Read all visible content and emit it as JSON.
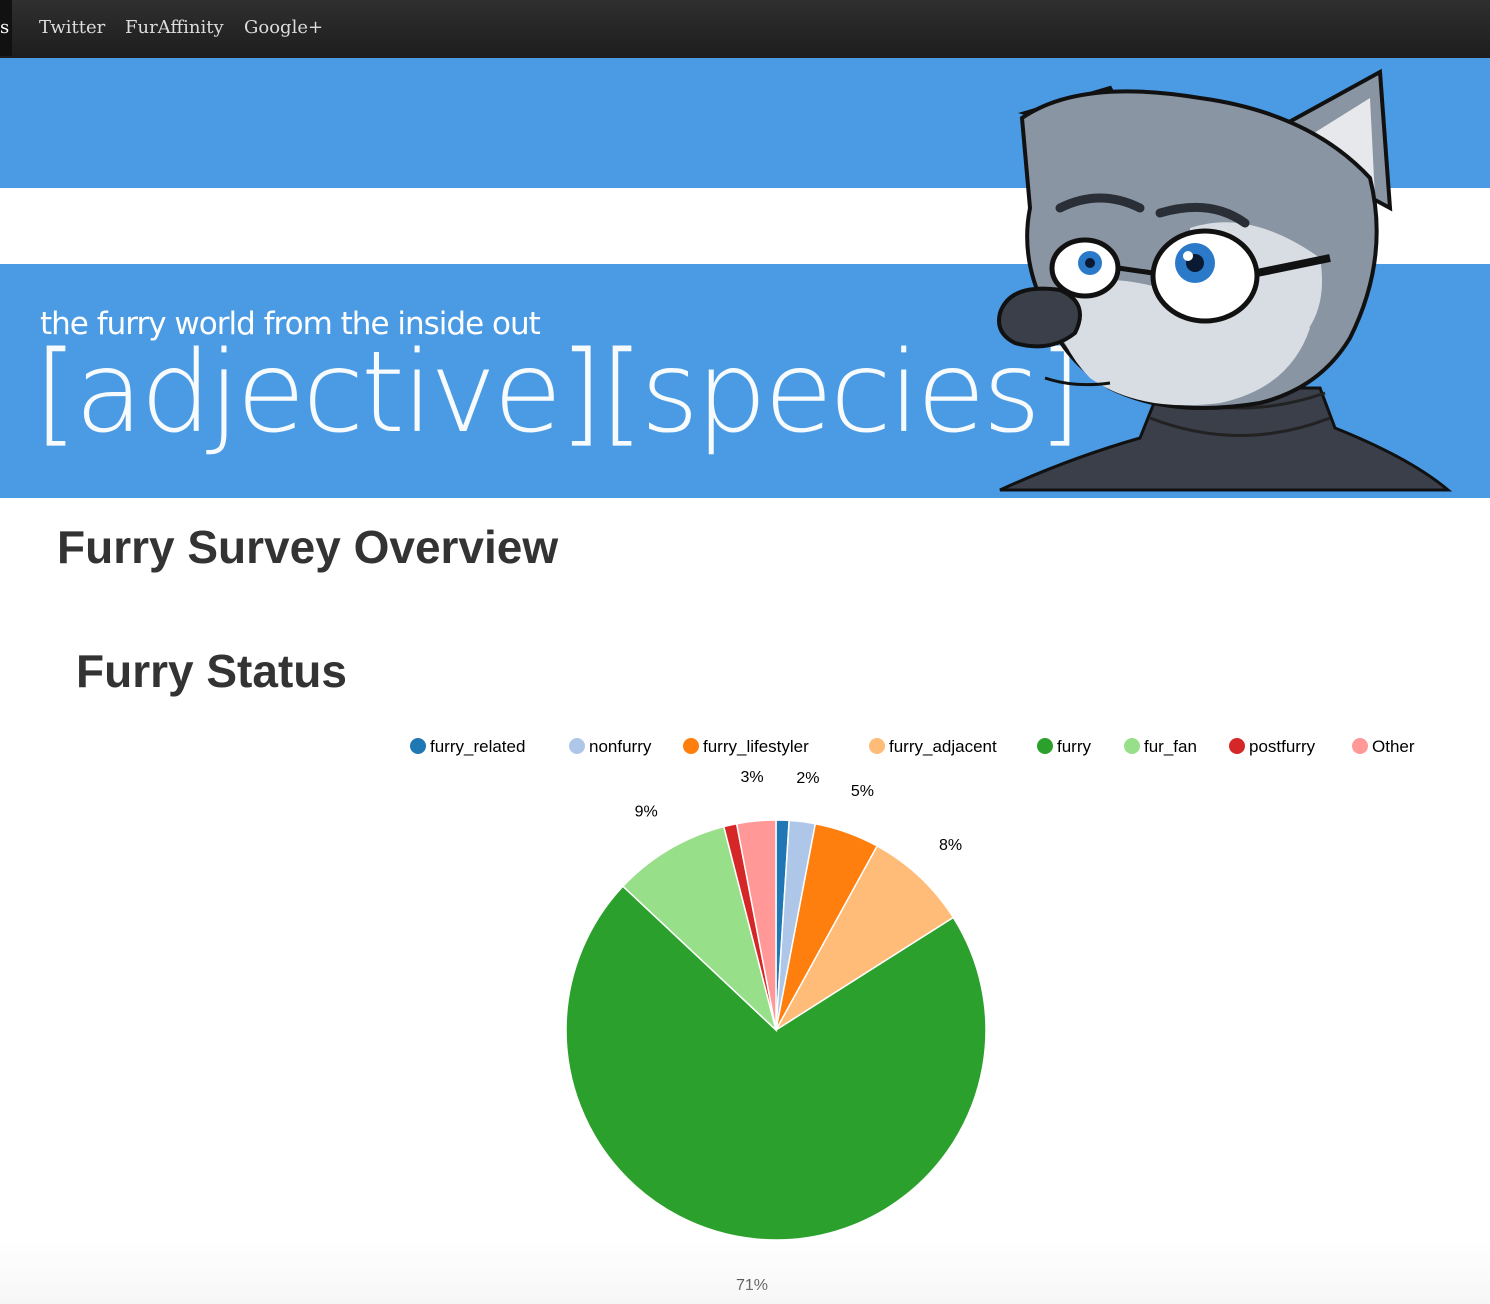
{
  "nav": {
    "items": [
      {
        "label": "s",
        "active": true
      },
      {
        "label": "Twitter",
        "active": false
      },
      {
        "label": "FurAffinity",
        "active": false
      },
      {
        "label": "Google+",
        "active": false
      }
    ]
  },
  "banner": {
    "tagline": "the furry world from the inside out",
    "title": "[adjective][species]",
    "mascot_icon": "wolf-mascot-with-glasses"
  },
  "page_title": "Furry Survey Overview",
  "section_title": "Furry Status",
  "colors": {
    "navbar": "#222222",
    "banner": "#4a9be4",
    "heading": "#333333"
  },
  "chart_data": {
    "type": "pie",
    "title": "Furry Status",
    "legend_position": "top",
    "series": [
      {
        "name": "furry_related",
        "value": 1,
        "label": "",
        "color": "#1f77b4"
      },
      {
        "name": "nonfurry",
        "value": 2,
        "label": "2%",
        "color": "#aec7e8"
      },
      {
        "name": "furry_lifestyler",
        "value": 5,
        "label": "5%",
        "color": "#ff7f0e"
      },
      {
        "name": "furry_adjacent",
        "value": 8,
        "label": "8%",
        "color": "#ffbb78"
      },
      {
        "name": "furry",
        "value": 71,
        "label": "71%",
        "color": "#2ca02c"
      },
      {
        "name": "fur_fan",
        "value": 9,
        "label": "9%",
        "color": "#98df8a"
      },
      {
        "name": "postfurry",
        "value": 1,
        "label": "",
        "color": "#d62728"
      },
      {
        "name": "Other",
        "value": 3,
        "label": "3%",
        "color": "#ff9896"
      }
    ]
  }
}
